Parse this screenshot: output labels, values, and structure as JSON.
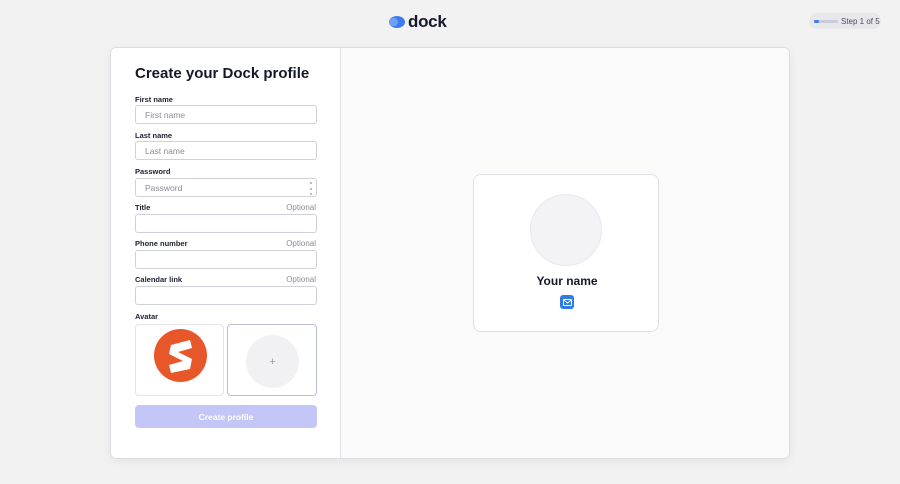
{
  "brand": {
    "name": "dock",
    "accent": "#3d7bf0"
  },
  "progress": {
    "label": "Step 1 of 5",
    "current": 1,
    "total": 5,
    "fraction": 0.2
  },
  "form": {
    "title": "Create your Dock profile",
    "fields": {
      "first_name": {
        "label": "First name",
        "placeholder": "First name",
        "value": ""
      },
      "last_name": {
        "label": "Last name",
        "placeholder": "Last name",
        "value": ""
      },
      "password": {
        "label": "Password",
        "placeholder": "Password",
        "value": ""
      },
      "title": {
        "label": "Title",
        "optional": "Optional",
        "value": ""
      },
      "phone": {
        "label": "Phone number",
        "optional": "Optional",
        "value": ""
      },
      "calendar": {
        "label": "Calendar link",
        "optional": "Optional",
        "value": ""
      }
    },
    "avatar": {
      "label": "Avatar",
      "add_symbol": "+",
      "logo_color": "#e8572a"
    },
    "submit_label": "Create profile"
  },
  "preview": {
    "name": "Your name",
    "contact_icon": "mail-icon"
  }
}
